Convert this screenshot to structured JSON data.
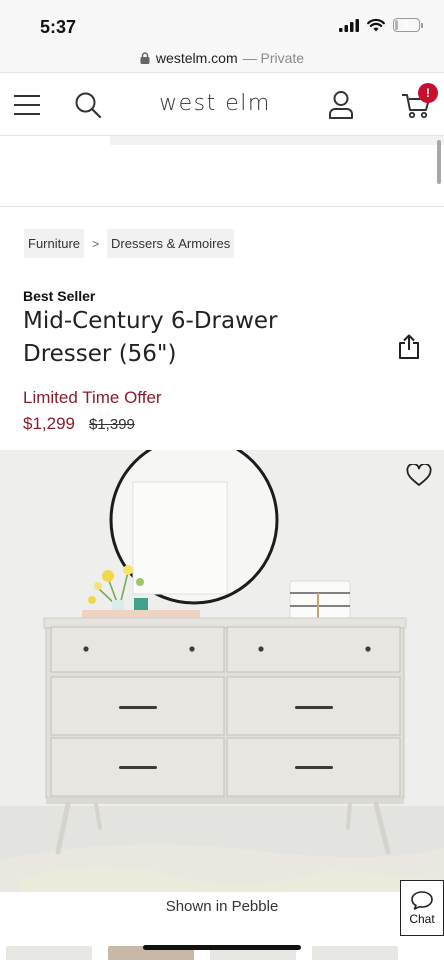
{
  "status_bar": {
    "time": "5:37",
    "battery": "7",
    "battery_level": 0.07
  },
  "browser": {
    "domain": "westelm.com",
    "private_label": "— Private"
  },
  "header": {
    "logo": "west elm",
    "cart_badge": "!"
  },
  "breadcrumb": [
    {
      "label": "Furniture"
    },
    {
      "label": "Dressers & Armoires"
    }
  ],
  "breadcrumb_separator": ">",
  "product": {
    "badge": "Best Seller",
    "title": "Mid-Century 6-Drawer Dresser (56\")",
    "offer_label": "Limited Time Offer",
    "sale_price": "$1,299",
    "original_price": "$1,399",
    "image_caption": "Shown in Pebble"
  },
  "chat": {
    "label": "Chat"
  },
  "colors": {
    "accent_red": "#8b1c2b",
    "badge_red": "#c8102e",
    "text": "#222222"
  },
  "icons": {
    "menu": "hamburger-menu-icon",
    "search": "search-icon",
    "account": "user-icon",
    "cart": "cart-icon",
    "share": "share-icon",
    "favorite": "heart-icon",
    "chat": "chat-bubble-icon",
    "lock": "lock-icon"
  }
}
